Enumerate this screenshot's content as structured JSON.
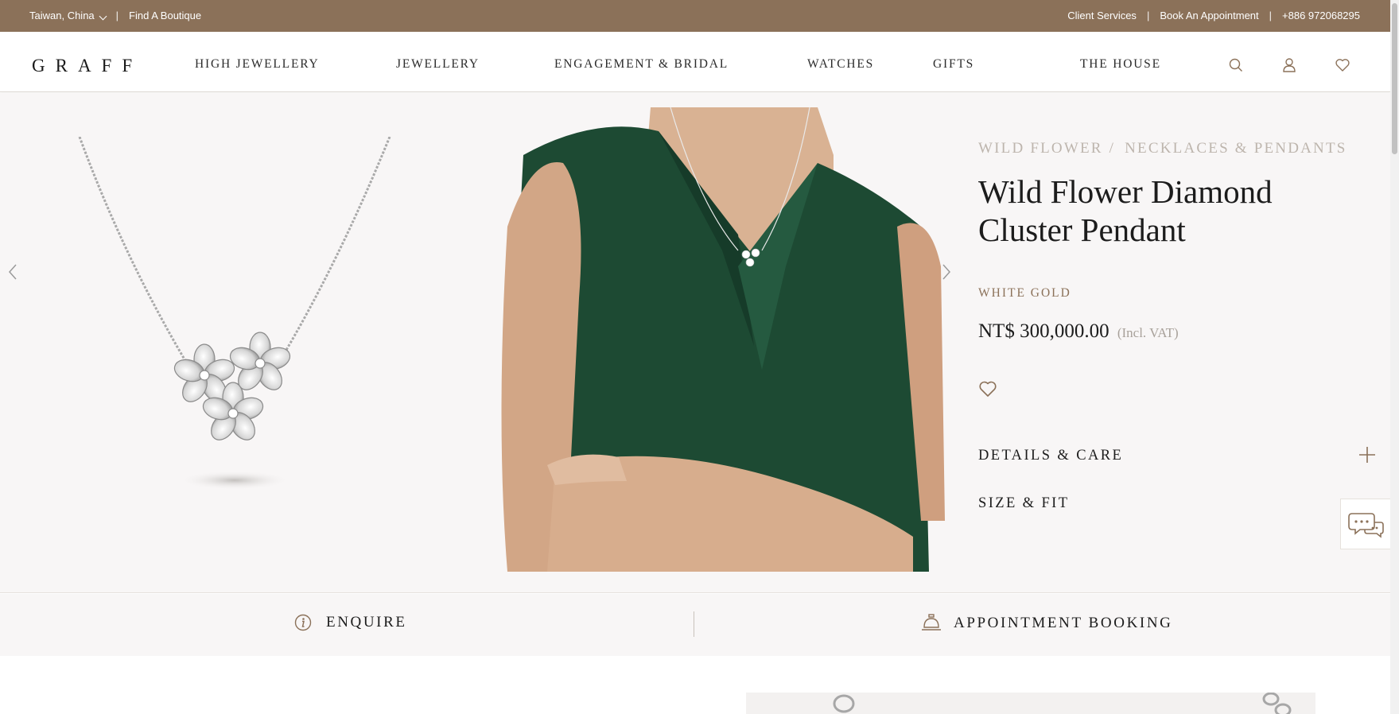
{
  "topbar": {
    "region": "Taiwan, China",
    "find_boutique": "Find A Boutique",
    "client_services": "Client Services",
    "book_appointment": "Book An Appointment",
    "phone": "+886 972068295"
  },
  "header": {
    "logo": "GRAFF",
    "nav": [
      "HIGH JEWELLERY",
      "JEWELLERY",
      "ENGAGEMENT & BRIDAL",
      "WATCHES",
      "GIFTS",
      "THE HOUSE"
    ],
    "icons": [
      "search-icon",
      "account-icon",
      "wishlist-icon"
    ]
  },
  "product": {
    "breadcrumb": [
      "WILD FLOWER",
      "NECKLACES & PENDANTS"
    ],
    "breadcrumb_sep": "/",
    "title": "Wild Flower Diamond Cluster Pendant",
    "metal": "WHITE GOLD",
    "price": "NT$ 300,000.00",
    "vat": "(Incl. VAT)",
    "accordions": [
      "DETAILS & CARE",
      "SIZE & FIT"
    ]
  },
  "actions": {
    "enquire": "ENQUIRE",
    "appointment": "APPOINTMENT BOOKING"
  },
  "colors": {
    "brand": "#8b7159",
    "background": "#f8f6f6",
    "dress": "#1d4a33"
  }
}
